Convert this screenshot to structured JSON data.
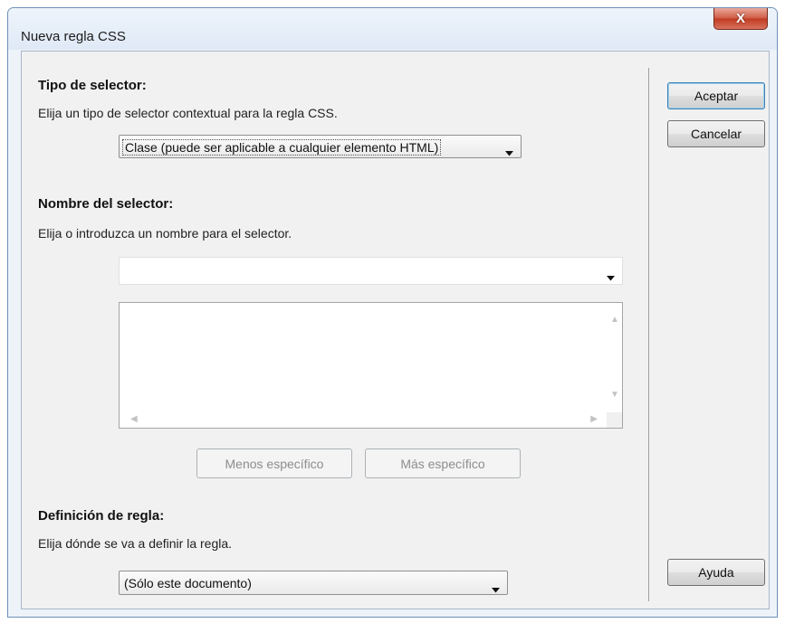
{
  "dialog": {
    "title": "Nueva regla CSS",
    "close_label": "X"
  },
  "selector_type": {
    "heading": "Tipo de selector:",
    "hint": "Elija un tipo de selector contextual para la regla CSS.",
    "selected": "Clase (puede ser aplicable a cualquier elemento HTML)"
  },
  "selector_name": {
    "heading": "Nombre del selector:",
    "hint": "Elija o introduzca un nombre para el selector.",
    "value": "",
    "less_specific_label": "Menos específico",
    "more_specific_label": "Más específico"
  },
  "rule_definition": {
    "heading": "Definición de regla:",
    "hint": "Elija dónde se va a definir la regla.",
    "selected": "(Sólo este documento)"
  },
  "buttons": {
    "ok": "Aceptar",
    "cancel": "Cancelar",
    "help": "Ayuda"
  },
  "colors": {
    "close_button": "#c13b22",
    "default_button_border": "#3c7fb1",
    "window_border": "#6d8fb8"
  }
}
